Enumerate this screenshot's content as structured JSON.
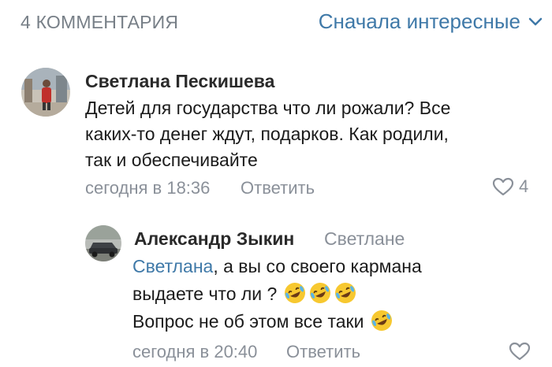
{
  "header": {
    "comments_count": "4 КОММЕНТАРИЯ",
    "sort_label": "Сначала интересные"
  },
  "comment1": {
    "author": "Светлана Пескишева",
    "lines": [
      "Детей для государства что ли рожали? Все",
      "каких-то денег ждут, подарков. Как родили,",
      "так и обеспечивайте"
    ],
    "time": "сегодня в 18:36",
    "reply_label": "Ответить",
    "likes": "4"
  },
  "reply1": {
    "author": "Александр Зыкин",
    "reply_to": "Светлане",
    "mention": "Светлана",
    "line1_rest": ", а вы со своего кармана",
    "line2": "выдаете что ли ?",
    "line3": "Вопрос не об этом все таки",
    "time": "сегодня в 20:40",
    "reply_label": "Ответить"
  },
  "icons": {
    "sort": "chevron-down-icon",
    "like": "heart-outline-icon",
    "emoji": "rolling-on-floor-laughing-emoji"
  },
  "colors": {
    "accent": "#3f79a8",
    "meta": "#8a9099",
    "text": "#1b1b1b"
  }
}
